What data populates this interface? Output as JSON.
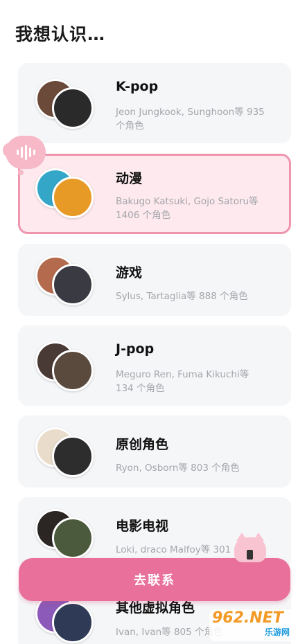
{
  "page": {
    "title": "我想认识…"
  },
  "categories": [
    {
      "title": "K-pop",
      "desc": "Jeon Jungkook, Sunghoon等 935 个角色",
      "selected": false,
      "back_color": "#6b4a3a",
      "front_color": "#2a2a2a"
    },
    {
      "title": "动漫",
      "desc": "Bakugo Katsuki, Gojo Satoru等 1406 个角色",
      "selected": true,
      "back_color": "#34a7c9",
      "front_color": "#e89a26"
    },
    {
      "title": "游戏",
      "desc": "Sylus, Tartaglia等 888 个角色",
      "selected": false,
      "back_color": "#b46a4c",
      "front_color": "#3a3a42"
    },
    {
      "title": "J-pop",
      "desc": "Meguro Ren, Fuma Kikuchi等 134 个角色",
      "selected": false,
      "back_color": "#4a3a36",
      "front_color": "#5a4a3e"
    },
    {
      "title": "原创角色",
      "desc": "Ryon, Osborn等 803 个角色",
      "selected": false,
      "back_color": "#e9dccb",
      "front_color": "#2d2d2d"
    },
    {
      "title": "电影电视",
      "desc": "Loki, draco Malfoy等 301 个角色",
      "selected": false,
      "back_color": "#2b2623",
      "front_color": "#4b5a3c"
    },
    {
      "title": "其他虚拟角色",
      "desc": "Ivan, Ivan等 805 个角色",
      "selected": false,
      "back_color": "#8c5ab8",
      "front_color": "#2f3a56"
    }
  ],
  "cta": {
    "label": "去联系"
  },
  "watermark": {
    "big": "962.NET",
    "small": "乐游网"
  },
  "colors": {
    "accent": "#e8709a",
    "card_bg": "#f5f6f8",
    "selected_bg": "#fde9ee",
    "selected_border": "#ef95ae"
  }
}
